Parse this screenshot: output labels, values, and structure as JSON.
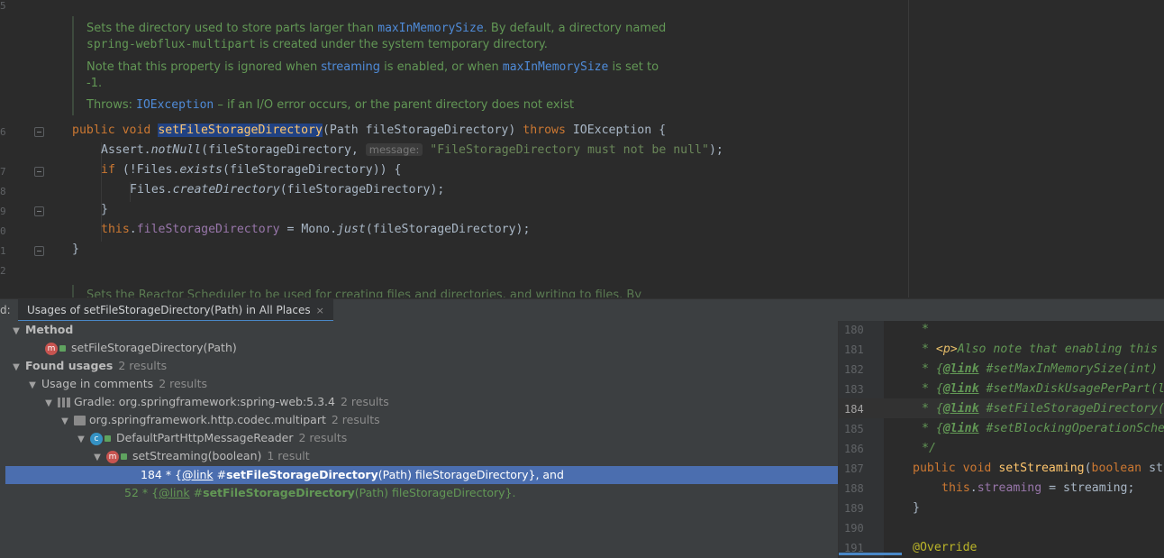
{
  "editor": {
    "gutter_numbers": [
      "5",
      "6",
      "7",
      "8",
      "9",
      "0",
      "1",
      "2"
    ],
    "doc1": {
      "p1_a": "Sets the directory used to store parts larger than ",
      "p1_link": "maxInMemorySize",
      "p1_b": ". By default, a directory named",
      "p1_code": "spring-webflux-multipart",
      "p1_c": " is created under the system temporary directory.",
      "p2_a": "Note that this property is ignored when ",
      "p2_link1": "streaming",
      "p2_b": " is enabled, or when ",
      "p2_link2": "maxInMemorySize",
      "p2_c": " is set to",
      "p2_d": "-1.",
      "throws_label": "Throws: ",
      "throws_link": "IOException",
      "throws_text": " – if an I/O error occurs, or the parent directory does not exist"
    },
    "code": {
      "l1_public": "public",
      "l1_void": "void",
      "l1_name": "setFileStorageDirectory",
      "l1_params": "(Path fileStorageDirectory) ",
      "l1_throws": "throws",
      "l1_rest": " IOException {",
      "l2_a": "Assert.",
      "l2_method": "notNull",
      "l2_b": "(fileStorageDirectory, ",
      "l2_hint": "message:",
      "l2_str": "\"FileStorageDirectory must not be null\"",
      "l2_c": ");",
      "l3_if": "if",
      "l3_a": " (!Files.",
      "l3_method": "exists",
      "l3_b": "(fileStorageDirectory)) {",
      "l4_a": "Files.",
      "l4_method": "createDirectory",
      "l4_b": "(fileStorageDirectory);",
      "l5": "}",
      "l6_this": "this",
      "l6_dot": ".",
      "l6_field": "fileStorageDirectory",
      "l6_a": " = Mono.",
      "l6_method": "just",
      "l6_b": "(fileStorageDirectory);",
      "l7": "}"
    },
    "doc2_cut": "Sets the Reactor Scheduler to be used for creating files and directories, and writing to files. By"
  },
  "find": {
    "label": "d:",
    "tab_title": "Usages of setFileStorageDirectory(Path) in All Places",
    "tab_close": "×",
    "tree": {
      "method_header": "Method",
      "method_item": "setFileStorageDirectory(Path)",
      "found_header": "Found usages",
      "found_count": "2 results",
      "usage_in_comments": "Usage in comments",
      "usage_in_comments_count": "2 results",
      "gradle": "Gradle: org.springframework:spring-web:5.3.4",
      "gradle_count": "2 results",
      "package": "org.springframework.http.codec.multipart",
      "package_count": "2 results",
      "class": "DefaultPartHttpMessageReader",
      "class_count": "2 results",
      "method": "setStreaming(boolean)",
      "method_count": "1 result",
      "usage1_prefix": "184 * {",
      "usage1_tag": "@link",
      "usage1_hash": " #",
      "usage1_name": "setFileStorageDirectory",
      "usage1_rest": "(Path) fileStorageDirectory}, and",
      "usage2_prefix": "52 * {",
      "usage2_tag": "@link",
      "usage2_hash": " #",
      "usage2_name": "setFileStorageDirectory",
      "usage2_rest": "(Path) fileStorageDirectory}."
    }
  },
  "preview": {
    "line_numbers": [
      "180",
      "181",
      "182",
      "183",
      "184",
      "185",
      "186",
      "187",
      "188",
      "189",
      "190",
      "191"
    ],
    "current_line": "184",
    "l180": "*",
    "l181_a": "* ",
    "l181_tag": "<p>",
    "l181_b": "Also note that enabling this",
    "l182_a": "* {",
    "l182_tag": "@link",
    "l182_b": " #setMaxInMemorySize(int)",
    "l183_a": "* {",
    "l183_tag": "@link",
    "l183_b": " #setMaxDiskUsagePerPart(l",
    "l184_a": "* {",
    "l184_tag": "@link",
    "l184_b": " #setFileStorageDirectory(",
    "l185_a": "* {",
    "l185_tag": "@link",
    "l185_b": " #setBlockingOperationSche",
    "l186": "*/",
    "l187_public": "public",
    "l187_void": "void",
    "l187_name": "setStreaming",
    "l187_a": "(",
    "l187_bool": "boolean",
    "l187_b": " st",
    "l188_this": "this",
    "l188_dot": ".",
    "l188_field": "streaming",
    "l188_rest": " = streaming;",
    "l189": "}",
    "l191": "@Override"
  },
  "colors": {
    "background": "#2b2b2b",
    "keyword": "#cc7832",
    "method_decl": "#ffc66d",
    "string": "#6a8759",
    "javadoc": "#629755",
    "selection": "#4b6eaf",
    "field": "#9876aa"
  }
}
